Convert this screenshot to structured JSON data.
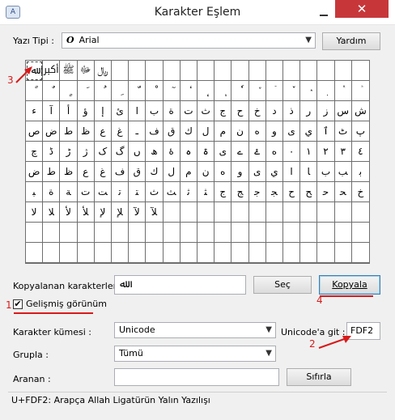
{
  "window": {
    "title": "Karakter Eşlem",
    "close_glyph": "✕"
  },
  "font_row": {
    "label": "Yazı Tipi :",
    "font_icon": "O",
    "font_value": "Arial",
    "help_button": "Yardım"
  },
  "grid_rows": [
    [
      "ﷲ",
      "ﷳ",
      "ﷺ",
      "ﷻ",
      "﷼",
      "",
      "",
      "",
      "",
      "",
      "",
      "",
      "",
      "",
      "",
      "",
      "",
      "",
      "",
      ""
    ],
    [
      "ً",
      "ٌ",
      "ٍ",
      "َ",
      "ُ",
      "ِ",
      "ّ",
      "ْ",
      "ٓ",
      "ٔ",
      "ٕ",
      "ٖ",
      "ٗ",
      "٘",
      "ٙ",
      "ٚ",
      "ٛ",
      "ٜ",
      "ٝ",
      "ٞ"
    ],
    [
      "ء",
      "آ",
      "أ",
      "ؤ",
      "إ",
      "ئ",
      "ا",
      "ب",
      "ة",
      "ت",
      "ث",
      "ج",
      "ح",
      "خ",
      "د",
      "ذ",
      "ر",
      "ز",
      "س",
      "ش"
    ],
    [
      "ص",
      "ض",
      "ط",
      "ظ",
      "ع",
      "غ",
      "ـ",
      "ف",
      "ق",
      "ك",
      "ل",
      "م",
      "ن",
      "ه",
      "و",
      "ى",
      "ي",
      "ٱ",
      "ٹ",
      "پ"
    ],
    [
      "چ",
      "ڈ",
      "ڑ",
      "ژ",
      "ک",
      "گ",
      "ں",
      "ھ",
      "ۀ",
      "ہ",
      "ۃ",
      "ی",
      "ے",
      "ۓ",
      "ە",
      "٠",
      "١",
      "٢",
      "٣",
      "٤"
    ],
    [
      "ض",
      "ط",
      "ظ",
      "ع",
      "غ",
      "ف",
      "ق",
      "ك",
      "ل",
      "م",
      "ن",
      "ه",
      "و",
      "ى",
      "ي",
      "ﺍ",
      "ﺎ",
      "ﺏ",
      "ﺐ",
      "ﺑ"
    ],
    [
      "ﺒ",
      "ﺓ",
      "ﺔ",
      "ﺕ",
      "ﺖ",
      "ﺗ",
      "ﺘ",
      "ﺙ",
      "ﺚ",
      "ﺛ",
      "ﺜ",
      "ﺝ",
      "ﺞ",
      "ﺟ",
      "ﺠ",
      "ﺡ",
      "ﺢ",
      "ﺣ",
      "ﺤ",
      "ﺥ"
    ],
    [
      "ﻻ",
      "ﻼ",
      "ﻷ",
      "ﻸ",
      "ﻹ",
      "ﻺ",
      "ﻵ",
      "ﻶ",
      "",
      "",
      "",
      "",
      "",
      "",
      "",
      "",
      "",
      "",
      "",
      ""
    ],
    [
      "",
      "",
      "",
      "",
      "",
      "",
      "",
      "",
      "",
      "",
      "",
      "",
      "",
      "",
      "",
      "",
      "",
      "",
      "",
      ""
    ],
    [
      "",
      "",
      "",
      "",
      "",
      "",
      "",
      "",
      "",
      "",
      "",
      "",
      "",
      "",
      "",
      "",
      "",
      "",
      "",
      ""
    ]
  ],
  "copy_row": {
    "label": "Kopyalanan karakterler :",
    "value": "ﷲ",
    "select_button": "Seç",
    "copy_button": "Kopyala"
  },
  "advanced": {
    "label": "Gelişmiş görünüm",
    "check": "✔"
  },
  "charset": {
    "label": "Karakter kümesi :",
    "value": "Unicode"
  },
  "unicode_goto": {
    "label": "Unicode'a git :",
    "value": "FDF2"
  },
  "group": {
    "label": "Grupla :",
    "value": "Tümü"
  },
  "search": {
    "label": "Aranan :",
    "value": "",
    "reset_button": "Sıfırla"
  },
  "status": {
    "text": "U+FDF2: Arapça Allah Ligatürün Yalın Yazılışı"
  },
  "annotations": {
    "n1": "1",
    "n2": "2",
    "n3": "3",
    "n4": "4"
  },
  "colors": {
    "annotation": "#d81a1a",
    "close_button": "#c7373a"
  }
}
